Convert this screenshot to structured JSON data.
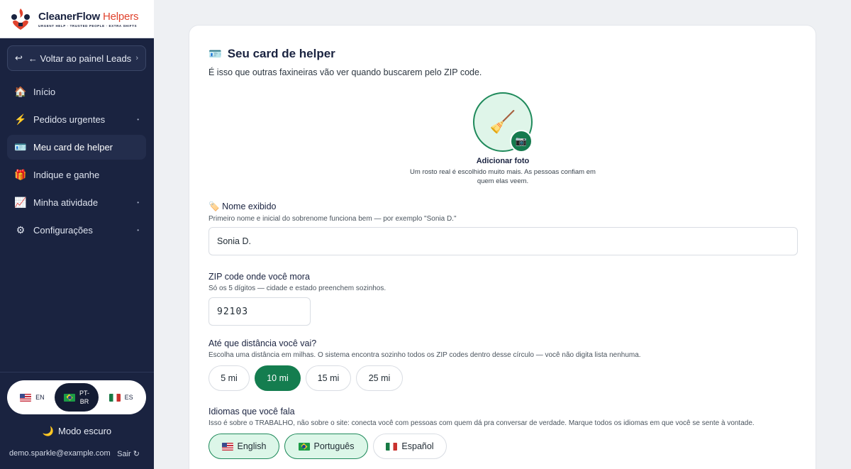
{
  "brand": {
    "name": "CleanerFlow",
    "name_accent": "Helpers",
    "tagline": "URGENT HELP · TRUSTED PEOPLE · EXTRA SHIFTS"
  },
  "sidebar": {
    "back_label": "← Voltar ao painel Leads",
    "items": [
      {
        "label": "Início",
        "icon": "house-icon"
      },
      {
        "label": "Pedidos urgentes",
        "icon": "lightning-icon"
      },
      {
        "label": "Meu card de helper",
        "icon": "id-card-icon"
      },
      {
        "label": "Indique e ganhe",
        "icon": "gift-icon"
      },
      {
        "label": "Minha atividade",
        "icon": "chart-icon"
      },
      {
        "label": "Configurações",
        "icon": "gear-icon"
      }
    ],
    "active_index": 2,
    "languages": [
      {
        "code": "EN"
      },
      {
        "code_line1": "PT-",
        "code_line2": "BR"
      },
      {
        "code": "ES"
      }
    ],
    "active_language": "PT-BR",
    "dark_mode_label": "Modo escuro",
    "user_email": "demo.sparkle@example.com",
    "logout_label": "Sair"
  },
  "card": {
    "title": "Seu card de helper",
    "subtitle": "É isso que outras faxineiras vão ver quando buscarem pelo ZIP code.",
    "photo": {
      "label": "Adicionar foto",
      "help": "Um rosto real é escolhido muito mais. As pessoas confiam em quem elas veem."
    },
    "name_field": {
      "label": "Nome exibido",
      "help": "Primeiro nome e inicial do sobrenome funciona bem — por exemplo \"Sonia D.\"",
      "value": "Sonia D."
    },
    "zip_field": {
      "label": "ZIP code onde você mora",
      "help": "Só os 5 dígitos — cidade e estado preenchem sozinhos.",
      "value": "92103"
    },
    "distance": {
      "label": "Até que distância você vai?",
      "help": "Escolha uma distância em milhas. O sistema encontra sozinho todos os ZIP codes dentro desse círculo — você não digita lista nenhuma.",
      "options": [
        "5 mi",
        "10 mi",
        "15 mi",
        "25 mi"
      ],
      "selected": "10 mi"
    },
    "languages": {
      "label": "Idiomas que você fala",
      "help": "Isso é sobre o TRABALHO, não sobre o site: conecta você com pessoas com quem dá pra conversar de verdade. Marque todos os idiomas em que você se sente à vontade.",
      "options": [
        "English",
        "Português",
        "Español"
      ],
      "selected": [
        "English",
        "Português"
      ]
    }
  },
  "colors": {
    "sidebar_bg": "#1a2340",
    "accent_green": "#147d4f",
    "soft_green": "#dcf6e8",
    "brand_red": "#e0432e"
  }
}
